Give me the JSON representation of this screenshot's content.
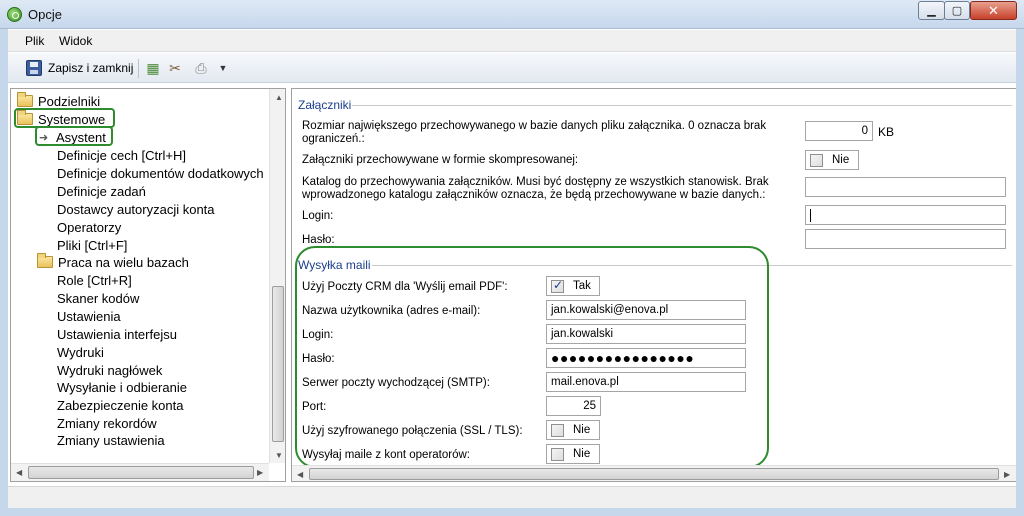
{
  "window": {
    "title": "Opcje"
  },
  "menu": {
    "items": [
      "Plik",
      "Widok"
    ]
  },
  "toolbar": {
    "save_label": "Zapisz i zamknij"
  },
  "tree": {
    "items": [
      {
        "label": "Podzielniki",
        "level": 0,
        "icon": "folder-icon"
      },
      {
        "label": "Systemowe",
        "level": 0,
        "icon": "folder-open-icon"
      },
      {
        "label": "Asystent",
        "level": 1,
        "icon": "arrow-icon"
      },
      {
        "label": "Definicje cech [Ctrl+H]",
        "level": 1
      },
      {
        "label": "Definicje dokumentów dodatkowych",
        "level": 1
      },
      {
        "label": "Definicje zadań",
        "level": 1
      },
      {
        "label": "Dostawcy autoryzacji konta",
        "level": 1
      },
      {
        "label": "Operatorzy",
        "level": 1
      },
      {
        "label": "Pliki [Ctrl+F]",
        "level": 1
      },
      {
        "label": "Praca na wielu bazach",
        "level": 1,
        "icon": "folder-icon"
      },
      {
        "label": "Role [Ctrl+R]",
        "level": 1
      },
      {
        "label": "Skaner kodów",
        "level": 1
      },
      {
        "label": "Ustawienia",
        "level": 1
      },
      {
        "label": "Ustawienia interfejsu",
        "level": 1
      },
      {
        "label": "Wydruki",
        "level": 1
      },
      {
        "label": "Wydruki nagłówek",
        "level": 1
      },
      {
        "label": "Wysyłanie i odbieranie",
        "level": 1
      },
      {
        "label": "Zabezpieczenie konta",
        "level": 1
      },
      {
        "label": "Zmiany rekordów",
        "level": 1
      },
      {
        "label": "Zmiany ustawienia",
        "level": 1
      }
    ]
  },
  "attachments": {
    "title": "Załączniki",
    "max_size_label": "Rozmiar największego przechowywanego w bazie danych pliku załącznika. 0 oznacza brak ograniczeń.:",
    "max_size_value": "0",
    "max_size_unit": "KB",
    "compressed_label": "Załączniki przechowywane w formie skompresowanej:",
    "compressed_value": "Nie",
    "catalog_label": "Katalog do przechowywania załączników. Musi być dostępny ze wszystkich stanowisk. Brak wprowadzonego katalogu załączników oznacza, że będą przechowywane w bazie danych.:",
    "catalog_value": "",
    "login_label": "Login:",
    "login_value": "",
    "password_label": "Hasło:",
    "password_value": ""
  },
  "mail": {
    "title": "Wysyłka maili",
    "use_crm_label": "Użyj Poczty CRM dla 'Wyślij email PDF':",
    "use_crm_value": "Tak",
    "use_crm_checked": true,
    "username_label": "Nazwa użytkownika (adres e-mail):",
    "username_value": "jan.kowalski@enova.pl",
    "login_label": "Login:",
    "login_value": "jan.kowalski",
    "password_label": "Hasło:",
    "password_value": "●●●●●●●●●●●●●●●●",
    "smtp_label": "Serwer poczty wychodzącej (SMTP):",
    "smtp_value": "mail.enova.pl",
    "port_label": "Port:",
    "port_value": "25",
    "ssl_label": "Użyj szyfrowanego połączenia (SSL / TLS):",
    "ssl_value": "Nie",
    "ssl_checked": false,
    "operators_label": "Wysyłaj maile z kont operatorów:",
    "operators_value": "Nie",
    "operators_checked": false
  },
  "colors": {
    "highlight": "#2e8b2e",
    "group_title": "#1b3f8a"
  }
}
